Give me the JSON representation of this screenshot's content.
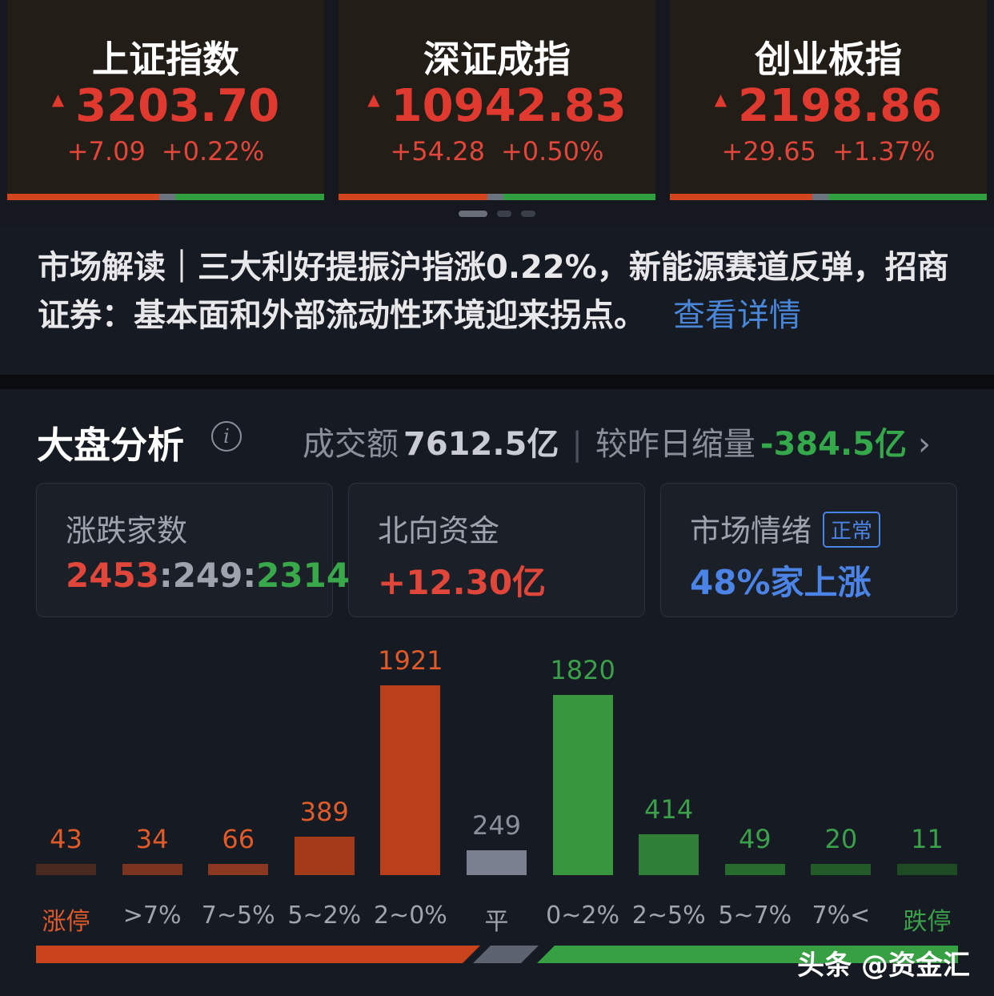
{
  "indices": [
    {
      "name": "上证指数",
      "value": "3203.70",
      "change": "+7.09",
      "percent": "+0.22%",
      "breadth": {
        "up": 0.48,
        "flat": 0.05,
        "down": 0.47
      }
    },
    {
      "name": "深证成指",
      "value": "10942.83",
      "change": "+54.28",
      "percent": "+0.50%",
      "breadth": {
        "up": 0.47,
        "flat": 0.05,
        "down": 0.48
      }
    },
    {
      "name": "创业板指",
      "value": "2198.86",
      "change": "+29.65",
      "percent": "+1.37%",
      "breadth": {
        "up": 0.45,
        "flat": 0.05,
        "down": 0.5
      }
    }
  ],
  "news": {
    "text": "市场解读｜三大利好提振沪指涨0.22%，新能源赛道反弹，招商证券：基本面和外部流动性环境迎来拐点。",
    "link": "查看详情"
  },
  "analysis": {
    "title": "大盘分析",
    "volume_label": "成交额",
    "volume_value": "7612.5亿",
    "compare_label": "较昨日缩量",
    "compare_value": "-384.5亿"
  },
  "stats": {
    "breadth": {
      "label": "涨跌家数",
      "up": "2453",
      "flat": "249",
      "down": "2314",
      "sep": ":"
    },
    "northbound": {
      "label": "北向资金",
      "value": "+12.30亿"
    },
    "sentiment": {
      "label": "市场情绪",
      "badge": "正常",
      "value": "48%家上涨"
    }
  },
  "chart_data": {
    "type": "bar",
    "categories": [
      "涨停",
      ">7%",
      "7~5%",
      "5~2%",
      "2~0%",
      "平",
      "0~2%",
      "2~5%",
      "5~7%",
      "7%<",
      "跌停"
    ],
    "values": [
      43,
      34,
      66,
      389,
      1921,
      249,
      1820,
      414,
      49,
      20,
      11
    ],
    "colors": [
      "#e05a2a",
      "#e05a2a",
      "#e05a2a",
      "#e05a2a",
      "#e05a2a",
      "#8a8f9a",
      "#3aa04a",
      "#3aa04a",
      "#3aa04a",
      "#3aa04a",
      "#3aa04a"
    ],
    "bar_colors": [
      "#4a2a1f",
      "#7a3420",
      "#8a3920",
      "#a33a1a",
      "#b9401a",
      "#7a8090",
      "#37963e",
      "#2f7f36",
      "#276b2e",
      "#225a28",
      "#1e4a24"
    ],
    "label_colors": [
      "#e05a2a",
      "#a0a4ad",
      "#a0a4ad",
      "#a0a4ad",
      "#a0a4ad",
      "#a0a4ad",
      "#a0a4ad",
      "#a0a4ad",
      "#a0a4ad",
      "#a0a4ad",
      "#3aa04a"
    ]
  },
  "summary_bar": {
    "up": 0.48,
    "flat": 0.05,
    "down": 0.47
  },
  "watermark": "头条 @资金汇"
}
